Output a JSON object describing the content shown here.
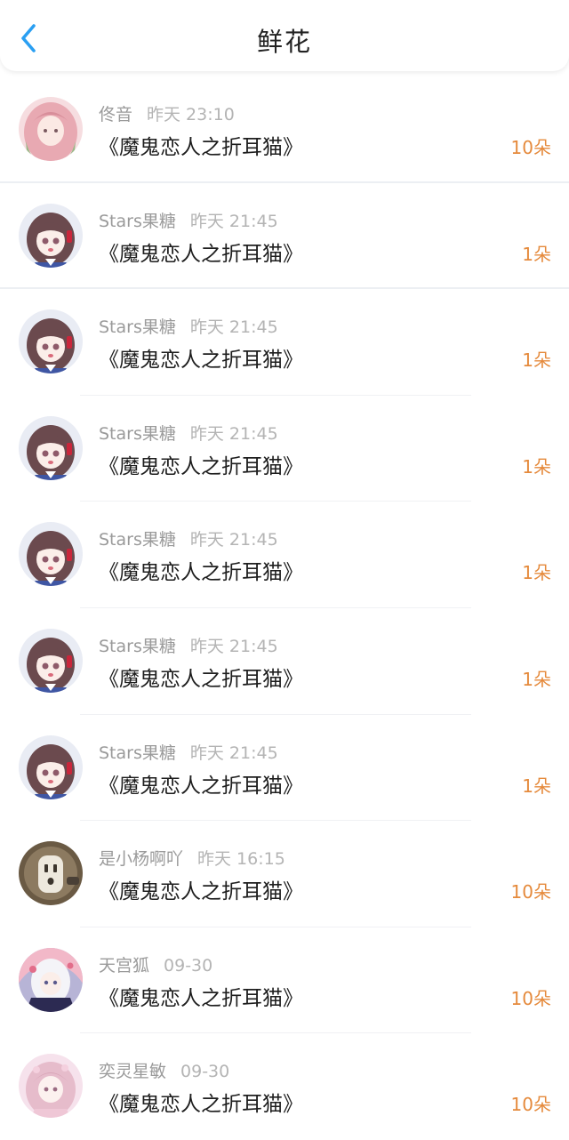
{
  "header": {
    "title": "鲜花",
    "back_icon": "chevron-left-icon",
    "accent_color": "#2a9ff2"
  },
  "colors": {
    "count": "#e58a3c",
    "username": "#9a9a9a",
    "time": "#b4b4b4",
    "book": "#1e1e1e"
  },
  "items": [
    {
      "user": "佟音",
      "time": "昨天 23:10",
      "book": "《魔鬼恋人之折耳猫》",
      "count": "10朵",
      "avatar": "pink-hair-avatar"
    },
    {
      "user": "Stars果糖",
      "time": "昨天 21:45",
      "book": "《魔鬼恋人之折耳猫》",
      "count": "1朵",
      "avatar": "brown-hair-girl-avatar"
    },
    {
      "user": "Stars果糖",
      "time": "昨天 21:45",
      "book": "《魔鬼恋人之折耳猫》",
      "count": "1朵",
      "avatar": "brown-hair-girl-avatar"
    },
    {
      "user": "Stars果糖",
      "time": "昨天 21:45",
      "book": "《魔鬼恋人之折耳猫》",
      "count": "1朵",
      "avatar": "brown-hair-girl-avatar"
    },
    {
      "user": "Stars果糖",
      "time": "昨天 21:45",
      "book": "《魔鬼恋人之折耳猫》",
      "count": "1朵",
      "avatar": "brown-hair-girl-avatar"
    },
    {
      "user": "Stars果糖",
      "time": "昨天 21:45",
      "book": "《魔鬼恋人之折耳猫》",
      "count": "1朵",
      "avatar": "brown-hair-girl-avatar"
    },
    {
      "user": "Stars果糖",
      "time": "昨天 21:45",
      "book": "《魔鬼恋人之折耳猫》",
      "count": "1朵",
      "avatar": "brown-hair-girl-avatar"
    },
    {
      "user": "是小杨啊吖",
      "time": "昨天 16:15",
      "book": "《魔鬼恋人之折耳猫》",
      "count": "10朵",
      "avatar": "power-socket-avatar"
    },
    {
      "user": "天宫狐",
      "time": "09-30",
      "book": "《魔鬼恋人之折耳猫》",
      "count": "10朵",
      "avatar": "white-hair-girl-avatar"
    },
    {
      "user": "奕灵星敏",
      "time": "09-30",
      "book": "《魔鬼恋人之折耳猫》",
      "count": "10朵",
      "avatar": "pink-girl-avatar"
    }
  ]
}
